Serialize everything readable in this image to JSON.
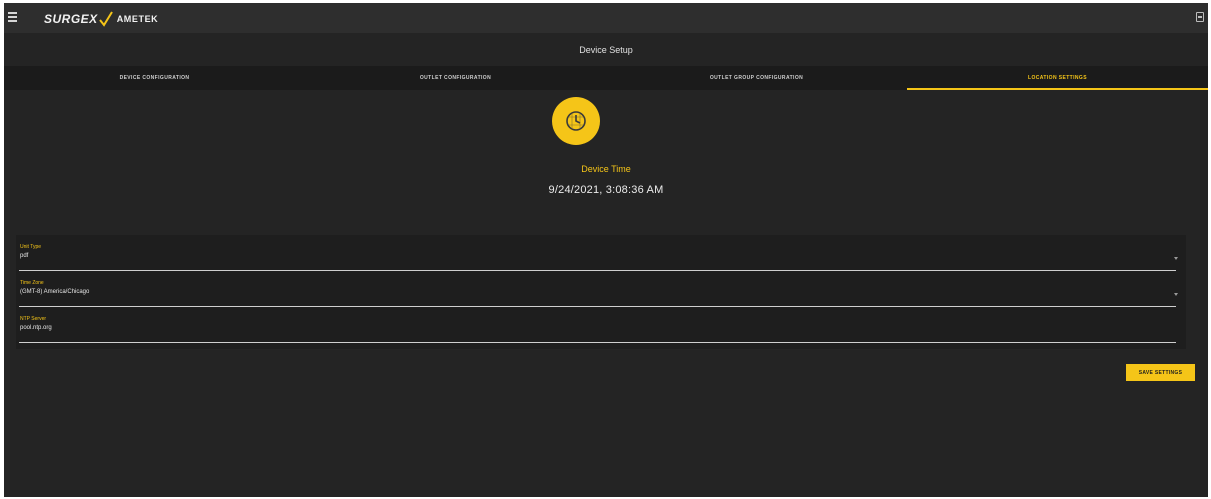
{
  "app": {
    "brand": "SURGEX",
    "partner": "AMETEK"
  },
  "header": {
    "title": "Device Setup"
  },
  "tabs": [
    {
      "label": "Device Configuration",
      "active": false
    },
    {
      "label": "Outlet Configuration",
      "active": false
    },
    {
      "label": "Outlet Group Configuration",
      "active": false
    },
    {
      "label": "Location Settings",
      "active": true
    }
  ],
  "device_time": {
    "label": "Device Time",
    "value": "9/24/2021, 3:08:36 AM",
    "icon": "clock-icon"
  },
  "form": {
    "fields": [
      {
        "label": "Unit Type",
        "value": "pdf"
      },
      {
        "label": "Time Zone",
        "value": "(GMT-8) America/Chicago"
      },
      {
        "label": "NTP Server",
        "value": "pool.ntp.org"
      }
    ]
  },
  "actions": {
    "save_label": "Save Settings"
  },
  "colors": {
    "accent": "#f5c518",
    "background": "#242424",
    "appbar": "#2e2e2e",
    "tabbar": "#1b1b1b",
    "panel": "#1e1e1e"
  }
}
